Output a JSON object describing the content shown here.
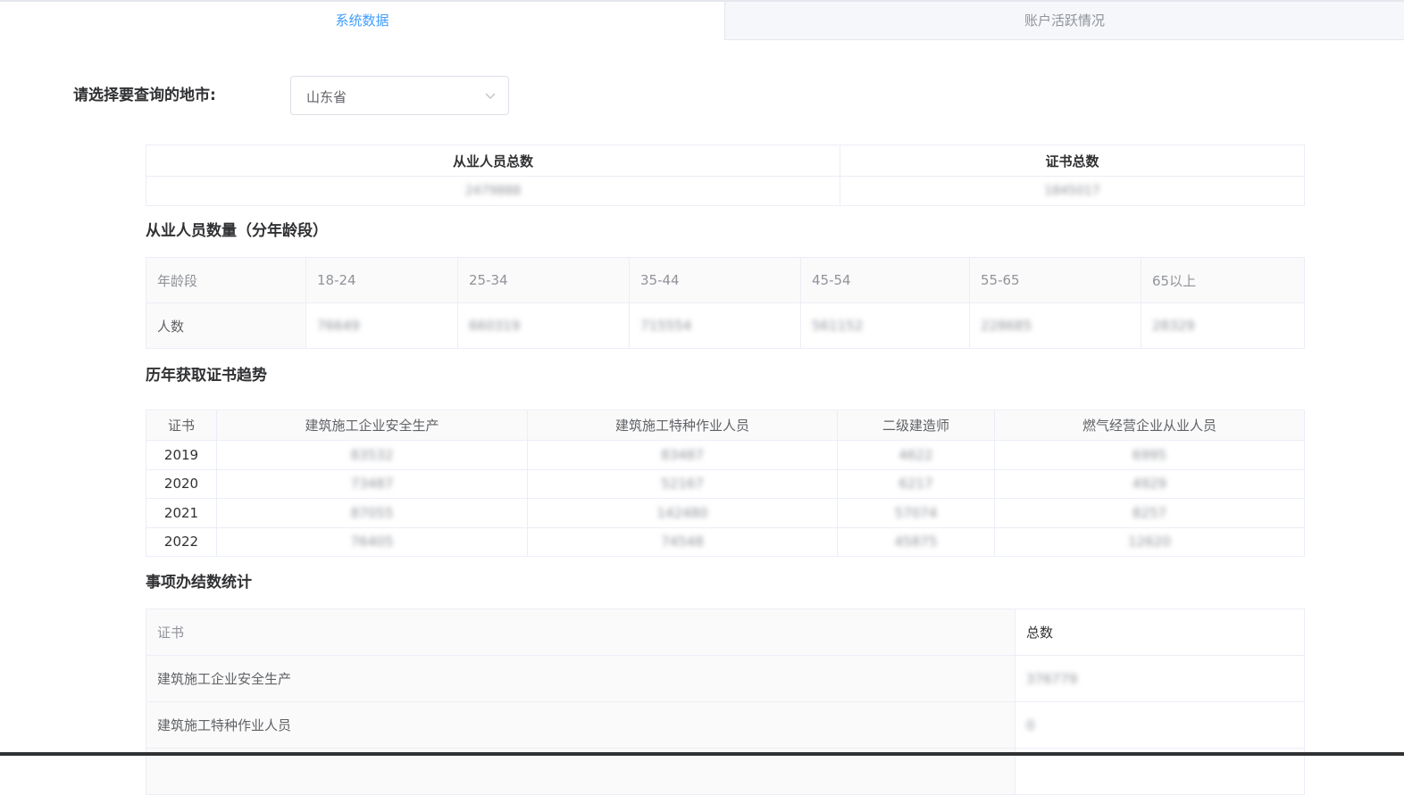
{
  "tabs": {
    "system": "系统数据",
    "activity": "账户活跃情况"
  },
  "region": {
    "label": "请选择要查询的地市:",
    "selected": "山东省"
  },
  "summary": {
    "headers": [
      "从业人员总数",
      "证书总数"
    ],
    "values": [
      "2479888",
      "1845017"
    ]
  },
  "age_section": {
    "title": "从业人员数量（分年龄段）",
    "header_label": "年龄段",
    "row_label": "人数",
    "ranges": [
      "18-24",
      "25-34",
      "35-44",
      "45-54",
      "55-65",
      "65以上"
    ],
    "counts": [
      "76649",
      "660319",
      "715554",
      "561152",
      "228685",
      "28329"
    ]
  },
  "trend_section": {
    "title": "历年获取证书趋势",
    "headers": [
      "证书",
      "建筑施工企业安全生产",
      "建筑施工特种作业人员",
      "二级建造师",
      "燃气经营企业从业人员"
    ],
    "rows": [
      [
        "2019",
        "83532",
        "83487",
        "4622",
        "6995"
      ],
      [
        "2020",
        "73487",
        "52167",
        "6217",
        "4929"
      ],
      [
        "2021",
        "87055",
        "142480",
        "57074",
        "8257"
      ],
      [
        "2022",
        "76405",
        "74548",
        "45875",
        "12620"
      ]
    ]
  },
  "done_section": {
    "title": "事项办结数统计",
    "headers": [
      "证书",
      "总数"
    ],
    "rows": [
      [
        "建筑施工企业安全生产",
        "376779"
      ],
      [
        "建筑施工特种作业人员",
        "0"
      ],
      [
        "",
        ""
      ]
    ]
  }
}
